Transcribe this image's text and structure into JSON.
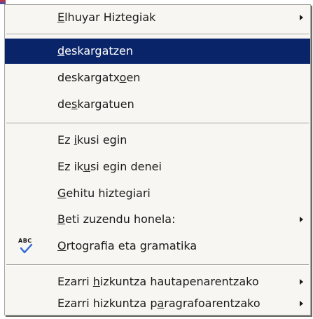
{
  "menu": {
    "items": [
      {
        "id": "elhuyar",
        "label": "Elhuyar Hiztegiak",
        "mnemonic_index": 0,
        "submenu": true,
        "highlight": false
      },
      {
        "id": "sug1",
        "label": "deskargatzen",
        "mnemonic_index": 0,
        "submenu": false,
        "highlight": true
      },
      {
        "id": "sug2",
        "label": "deskargatxoen",
        "mnemonic_index": 10,
        "submenu": false,
        "highlight": false
      },
      {
        "id": "sug3",
        "label": "deskargatuen",
        "mnemonic_index": 2,
        "submenu": false,
        "highlight": false
      },
      {
        "id": "ignore",
        "label": "Ez ikusi egin",
        "mnemonic_index": 3,
        "submenu": false,
        "highlight": false
      },
      {
        "id": "ignore_all",
        "label": "Ez ikusi egin denei",
        "mnemonic_index": 5,
        "submenu": false,
        "highlight": false
      },
      {
        "id": "add_dict",
        "label": "Gehitu hiztegiari",
        "mnemonic_index": 0,
        "submenu": false,
        "highlight": false
      },
      {
        "id": "autocorrect",
        "label": "Beti zuzendu honela:",
        "mnemonic_index": 0,
        "submenu": true,
        "highlight": false
      },
      {
        "id": "spelling",
        "label": "Ortografia eta gramatika",
        "mnemonic_index": 0,
        "submenu": false,
        "highlight": false,
        "icon": "spellcheck-abc-icon",
        "icon_text": "ABC"
      },
      {
        "id": "lang_sel",
        "label": "Ezarri hizkuntza hautapenarentzako",
        "mnemonic_index": 7,
        "submenu": true,
        "highlight": false
      },
      {
        "id": "lang_para",
        "label": "Ezarri hizkuntza paragrafoarentzako",
        "mnemonic_index": 18,
        "submenu": true,
        "highlight": false
      }
    ]
  },
  "colors": {
    "highlight_bg": "#0a246a",
    "highlight_text": "#ffffff",
    "menu_bg": "#f7f6f3",
    "text": "#1a1a1a"
  }
}
